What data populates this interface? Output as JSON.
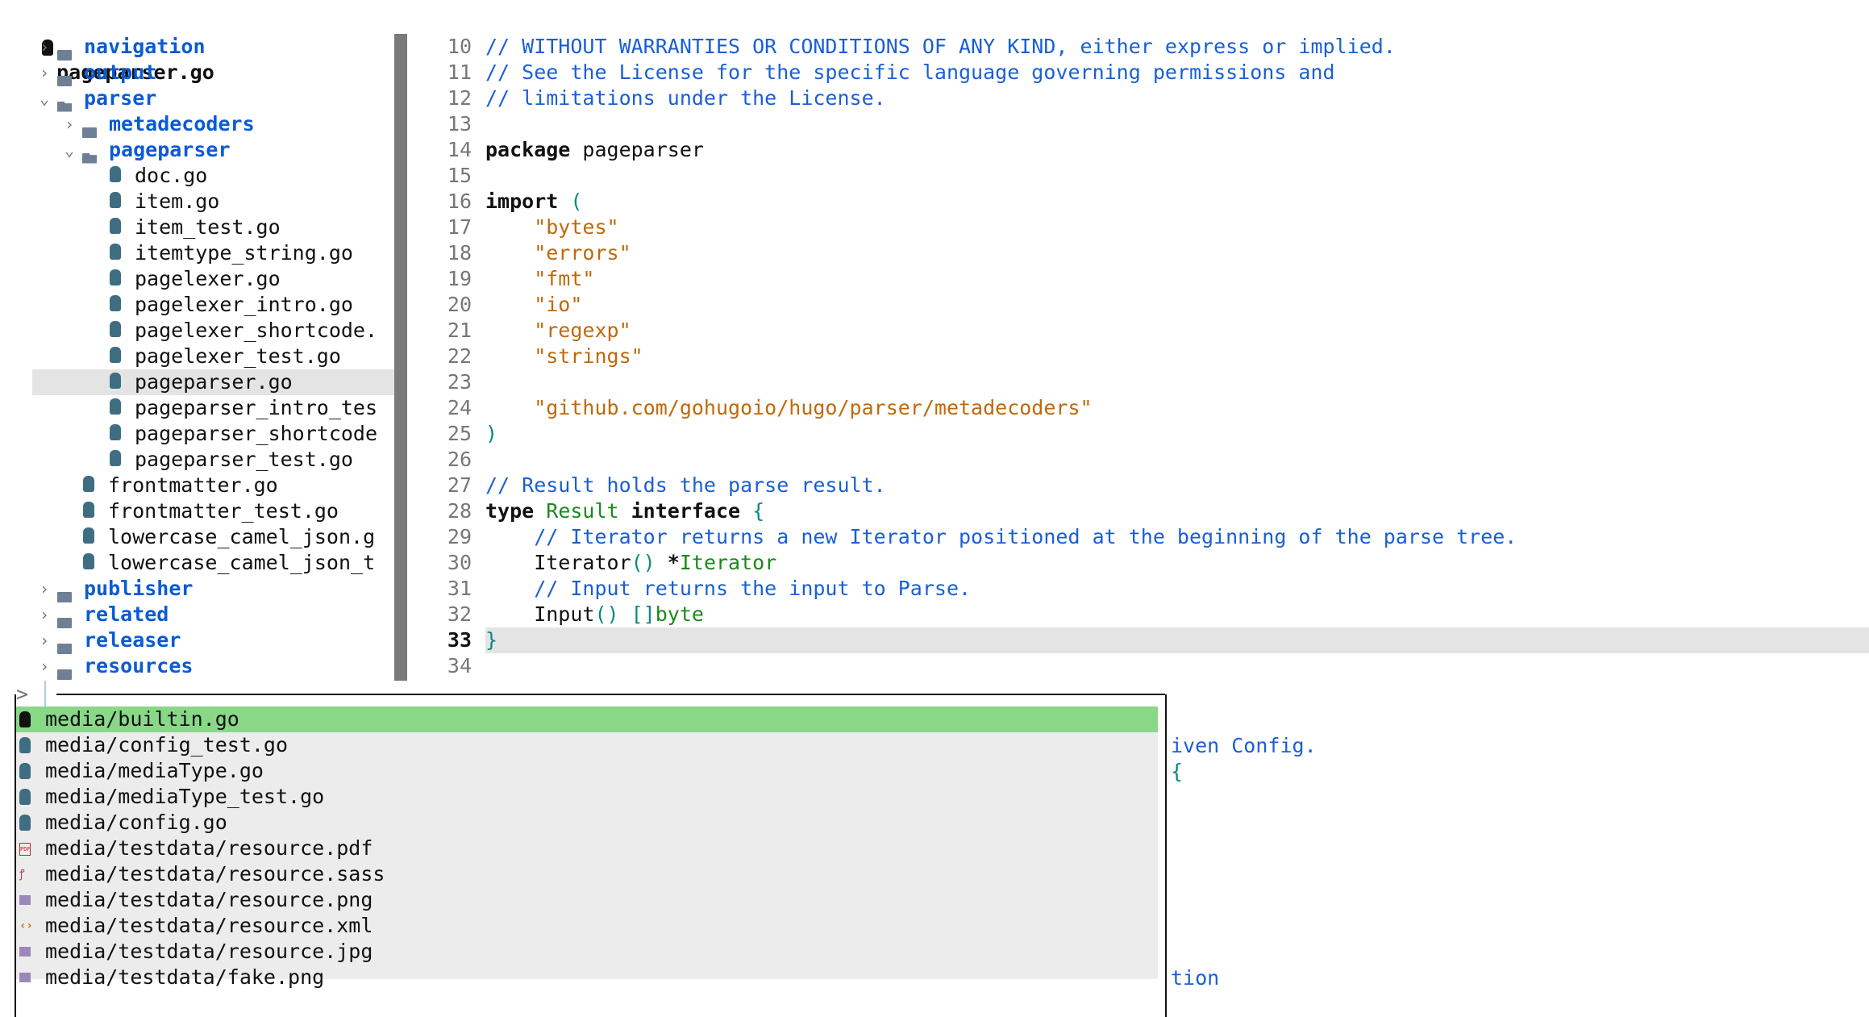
{
  "title": "pageparser.go",
  "tree": [
    {
      "type": "dir",
      "name": "navigation",
      "level": 0,
      "open": false
    },
    {
      "type": "dir",
      "name": "output",
      "level": 0,
      "open": false
    },
    {
      "type": "dir",
      "name": "parser",
      "level": 0,
      "open": true
    },
    {
      "type": "dir",
      "name": "metadecoders",
      "level": 1,
      "open": false
    },
    {
      "type": "dir",
      "name": "pageparser",
      "level": 1,
      "open": true
    },
    {
      "type": "file",
      "name": "doc.go",
      "level": 2
    },
    {
      "type": "file",
      "name": "item.go",
      "level": 2
    },
    {
      "type": "file",
      "name": "item_test.go",
      "level": 2
    },
    {
      "type": "file",
      "name": "itemtype_string.go",
      "level": 2
    },
    {
      "type": "file",
      "name": "pagelexer.go",
      "level": 2
    },
    {
      "type": "file",
      "name": "pagelexer_intro.go",
      "level": 2
    },
    {
      "type": "file",
      "name": "pagelexer_shortcode.",
      "level": 2
    },
    {
      "type": "file",
      "name": "pagelexer_test.go",
      "level": 2
    },
    {
      "type": "file",
      "name": "pageparser.go",
      "level": 2,
      "selected": true
    },
    {
      "type": "file",
      "name": "pageparser_intro_tes",
      "level": 2
    },
    {
      "type": "file",
      "name": "pageparser_shortcode",
      "level": 2
    },
    {
      "type": "file",
      "name": "pageparser_test.go",
      "level": 2
    },
    {
      "type": "file",
      "name": "frontmatter.go",
      "level": 1
    },
    {
      "type": "file",
      "name": "frontmatter_test.go",
      "level": 1
    },
    {
      "type": "file",
      "name": "lowercase_camel_json.g",
      "level": 1
    },
    {
      "type": "file",
      "name": "lowercase_camel_json_t",
      "level": 1
    },
    {
      "type": "dir",
      "name": "publisher",
      "level": 0,
      "open": false
    },
    {
      "type": "dir",
      "name": "related",
      "level": 0,
      "open": false
    },
    {
      "type": "dir",
      "name": "releaser",
      "level": 0,
      "open": false
    },
    {
      "type": "dir",
      "name": "resources",
      "level": 0,
      "open": false
    }
  ],
  "editor": {
    "current_line": 33,
    "lines": [
      {
        "n": "10",
        "tokens": [
          [
            "// WITHOUT WARRANTIES OR CONDITIONS OF ANY KIND, either express or implied.",
            "c"
          ]
        ]
      },
      {
        "n": "11",
        "tokens": [
          [
            "// See the License for the specific language governing permissions and",
            "c"
          ]
        ]
      },
      {
        "n": "12",
        "tokens": [
          [
            "// limitations under the License.",
            "c"
          ]
        ]
      },
      {
        "n": "13",
        "tokens": []
      },
      {
        "n": "14",
        "tokens": [
          [
            "package",
            "k"
          ],
          [
            " pageparser",
            "n"
          ]
        ]
      },
      {
        "n": "15",
        "tokens": []
      },
      {
        "n": "16",
        "tokens": [
          [
            "import",
            "k"
          ],
          [
            " (",
            "p"
          ]
        ]
      },
      {
        "n": "17",
        "tokens": [
          [
            "    \"bytes\"",
            "s"
          ]
        ]
      },
      {
        "n": "18",
        "tokens": [
          [
            "    \"errors\"",
            "s"
          ]
        ]
      },
      {
        "n": "19",
        "tokens": [
          [
            "    \"fmt\"",
            "s"
          ]
        ]
      },
      {
        "n": "20",
        "tokens": [
          [
            "    \"io\"",
            "s"
          ]
        ]
      },
      {
        "n": "21",
        "tokens": [
          [
            "    \"regexp\"",
            "s"
          ]
        ]
      },
      {
        "n": "22",
        "tokens": [
          [
            "    \"strings\"",
            "s"
          ]
        ]
      },
      {
        "n": "23",
        "tokens": []
      },
      {
        "n": "24",
        "tokens": [
          [
            "    \"github.com/gohugoio/hugo/parser/metadecoders\"",
            "s"
          ]
        ]
      },
      {
        "n": "25",
        "tokens": [
          [
            ")",
            "p"
          ]
        ]
      },
      {
        "n": "26",
        "tokens": []
      },
      {
        "n": "27",
        "tokens": [
          [
            "// Result holds the parse result.",
            "c"
          ]
        ]
      },
      {
        "n": "28",
        "tokens": [
          [
            "type",
            "k"
          ],
          [
            " Result",
            "t"
          ],
          [
            " interface",
            "k"
          ],
          [
            " {",
            "p"
          ]
        ]
      },
      {
        "n": "29",
        "tokens": [
          [
            "    // Iterator returns a new Iterator positioned at the beginning of the parse tree.",
            "c"
          ]
        ]
      },
      {
        "n": "30",
        "tokens": [
          [
            "    Iterator",
            "n"
          ],
          [
            "()",
            "p"
          ],
          [
            " *",
            "k"
          ],
          [
            "Iterator",
            "t"
          ]
        ]
      },
      {
        "n": "31",
        "tokens": [
          [
            "    // Input returns the input to Parse.",
            "c"
          ]
        ]
      },
      {
        "n": "32",
        "tokens": [
          [
            "    Input",
            "n"
          ],
          [
            "()",
            "p"
          ],
          [
            " []",
            "p"
          ],
          [
            "byte",
            "t"
          ]
        ]
      },
      {
        "n": "33",
        "tokens": [
          [
            "}",
            "p"
          ]
        ]
      },
      {
        "n": "34",
        "tokens": []
      }
    ],
    "peek": [
      {
        "text": "iven Config.",
        "cls": "c"
      },
      {
        "text": "{",
        "cls": "p"
      },
      {
        "text": "tion",
        "cls": "c"
      }
    ]
  },
  "finder": {
    "prompt": ">",
    "query": "",
    "items": [
      {
        "label": "media/builtin.go",
        "icon": "go",
        "active": true
      },
      {
        "label": "media/config_test.go",
        "icon": "go"
      },
      {
        "label": "media/mediaType.go",
        "icon": "go"
      },
      {
        "label": "media/mediaType_test.go",
        "icon": "go"
      },
      {
        "label": "media/config.go",
        "icon": "go"
      },
      {
        "label": "media/testdata/resource.pdf",
        "icon": "pdf"
      },
      {
        "label": "media/testdata/resource.sass",
        "icon": "sass"
      },
      {
        "label": "media/testdata/resource.png",
        "icon": "img"
      },
      {
        "label": "media/testdata/resource.xml",
        "icon": "xml"
      },
      {
        "label": "media/testdata/resource.jpg",
        "icon": "img"
      },
      {
        "label": "media/testdata/fake.png",
        "icon": "img"
      }
    ]
  },
  "colors": {
    "comment": "#1a5fd6",
    "string": "#c0690a",
    "type": "#1a8a1a",
    "bracket": "#0a8a80",
    "active": "#88d888"
  }
}
